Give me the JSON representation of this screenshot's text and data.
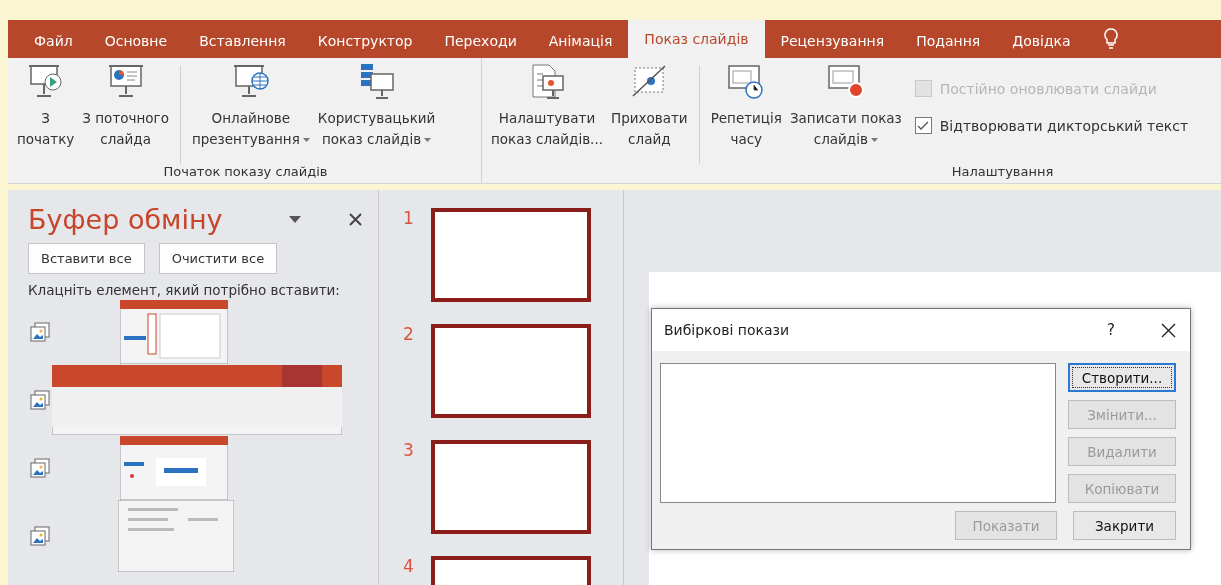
{
  "tabs": [
    {
      "label": "Файл",
      "selected": false
    },
    {
      "label": "Основне",
      "selected": false
    },
    {
      "label": "Вставлення",
      "selected": false
    },
    {
      "label": "Конструктор",
      "selected": false
    },
    {
      "label": "Переходи",
      "selected": false
    },
    {
      "label": "Анімація",
      "selected": false
    },
    {
      "label": "Показ слайдів",
      "selected": true
    },
    {
      "label": "Рецензування",
      "selected": false
    },
    {
      "label": "Подання",
      "selected": false
    },
    {
      "label": "Довідка",
      "selected": false
    }
  ],
  "ribbon": [
    {
      "label": "Початок показу слайдів",
      "buttons": [
        {
          "label": "З\nпочатку",
          "dropdown": false
        },
        {
          "label": "З поточного\nслайда",
          "dropdown": false
        },
        {
          "label": "Онлайнове\nпрезентування",
          "dropdown": true
        },
        {
          "label": "Користувацький\nпоказ слайдів",
          "dropdown": true
        }
      ]
    },
    {
      "label": "Налаштування",
      "buttons": [
        {
          "label": "Налаштувати\nпоказ слайдів...",
          "dropdown": false
        },
        {
          "label": "Приховати\nслайд",
          "dropdown": false
        },
        {
          "label": "Репетиція\nчасу",
          "dropdown": false
        },
        {
          "label": "Записати показ\nслайдів",
          "dropdown": true
        }
      ],
      "checkboxes": [
        {
          "label": "Постійно оновлювати слайди",
          "checked": false,
          "disabled": true
        },
        {
          "label": "Відтворювати дикторський текст",
          "checked": true,
          "disabled": false
        }
      ]
    }
  ],
  "clipboard": {
    "title": "Буфер обміну",
    "buttons": [
      "Вставити все",
      "Очистити все"
    ],
    "hint": "Клацніть елемент, який потрібно вставити:"
  },
  "slides": [
    {
      "number": "1",
      "selected": true
    },
    {
      "number": "2",
      "selected": true
    },
    {
      "number": "3",
      "selected": true
    },
    {
      "number": "4",
      "selected": true
    }
  ],
  "dialog": {
    "title": "Вибіркові покази",
    "help": "?",
    "buttons": [
      {
        "label": "Створити...",
        "disabled": false,
        "focused": true
      },
      {
        "label": "Змінити...",
        "disabled": true,
        "focused": false
      },
      {
        "label": "Видалити",
        "disabled": true,
        "focused": false
      },
      {
        "label": "Копіювати",
        "disabled": true,
        "focused": false
      }
    ],
    "footer_buttons": [
      {
        "label": "Показати",
        "disabled": true
      },
      {
        "label": "Закрити",
        "disabled": false
      }
    ]
  }
}
